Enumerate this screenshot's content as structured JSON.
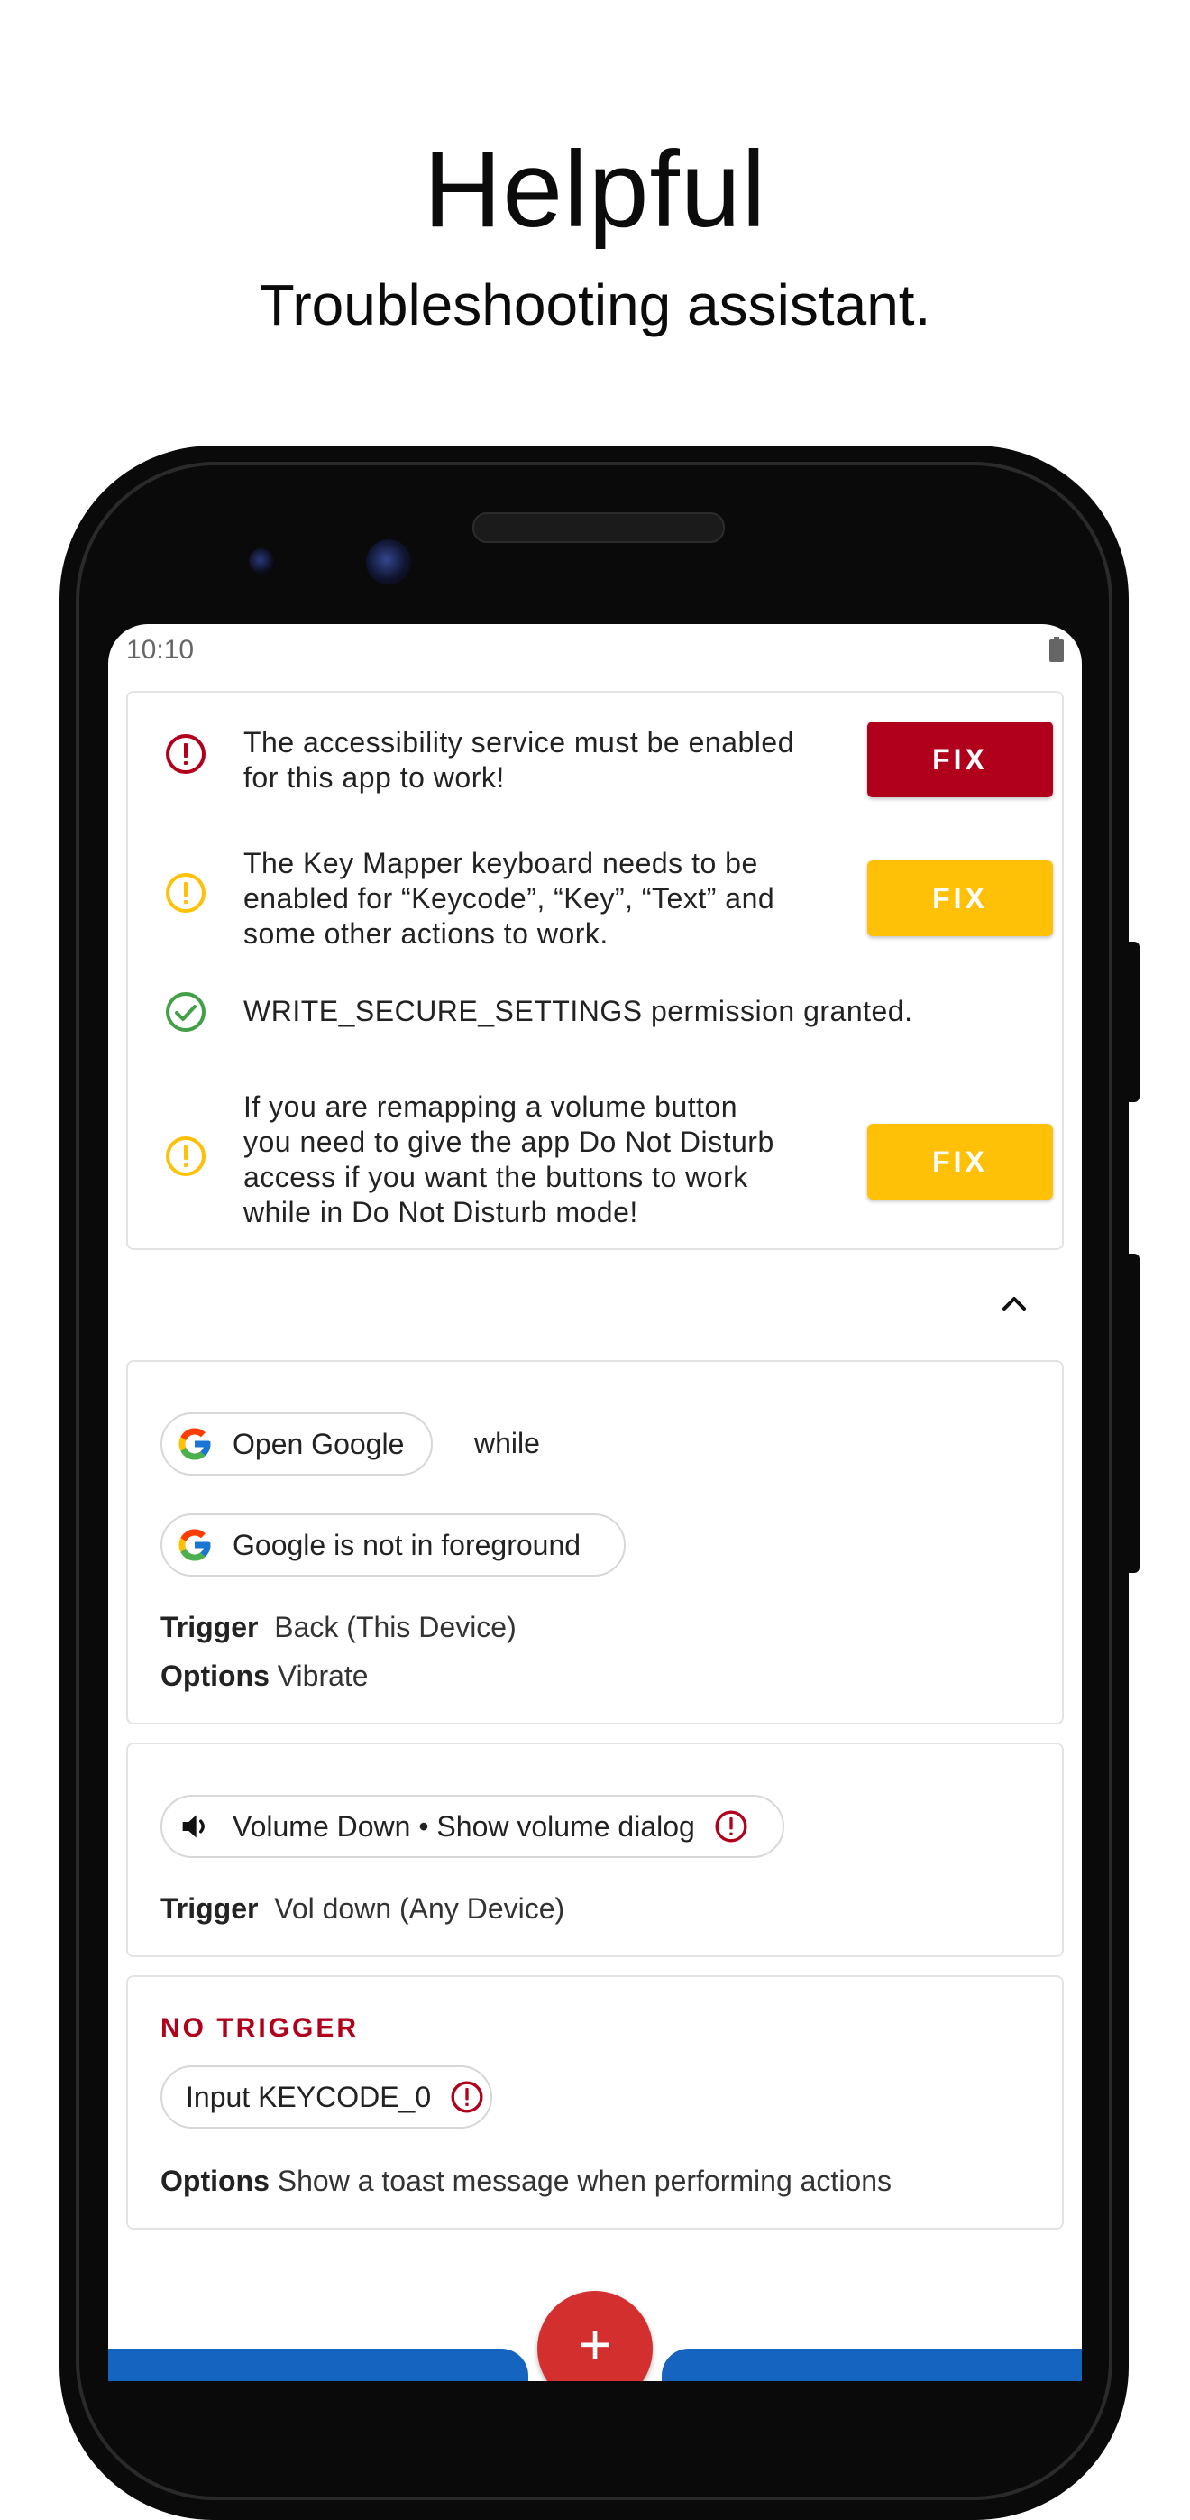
{
  "hero": {
    "title": "Helpful",
    "subtitle": "Troubleshooting assistant."
  },
  "status_bar": {
    "time": "10:10",
    "battery_icon": "battery-icon"
  },
  "colors": {
    "error_red": "#b1001c",
    "warn_amber": "#ffc107",
    "ok_green": "#43a047",
    "fab_red": "#d32f2f",
    "bar_blue": "#1565c0"
  },
  "checklist": [
    {
      "status": "error",
      "icon": "error-circle-icon",
      "text_lines": [
        "The accessibility service must be enabled",
        "for this app to work!"
      ],
      "button": "FIX"
    },
    {
      "status": "warning",
      "icon": "warning-circle-icon",
      "text_lines": [
        "The Key Mapper keyboard needs to be",
        "enabled for “Keycode”, “Key”, “Text” and",
        "some other actions to work."
      ],
      "button": "FIX"
    },
    {
      "status": "ok",
      "icon": "check-circle-icon",
      "text_lines": [
        "WRITE_SECURE_SETTINGS permission granted."
      ]
    },
    {
      "status": "warning",
      "icon": "warning-circle-icon",
      "text_lines": [
        "If you are remapping a volume button",
        "you need to give the app Do Not Disturb",
        "access if you want the buttons to work",
        "while in Do Not Disturb mode!"
      ],
      "button": "FIX"
    }
  ],
  "collapse_icon": "chevron-up-icon",
  "keymaps": [
    {
      "action_chip": "Open Google",
      "connector": "while",
      "constraint_chip": "Google is not in foreground",
      "trigger_label": "Trigger",
      "trigger_value": "Back (This Device)",
      "options_label": "Options",
      "options_value": "Vibrate"
    },
    {
      "action_chip": "Volume Down • Show volume dialog",
      "trigger_label": "Trigger",
      "trigger_value": "Vol down (Any Device)"
    },
    {
      "header": "NO TRIGGER",
      "action_chip": "Input KEYCODE_0",
      "options_label": "Options",
      "options_value": "Show a toast message when performing actions"
    }
  ],
  "fab": {
    "label": "+"
  }
}
